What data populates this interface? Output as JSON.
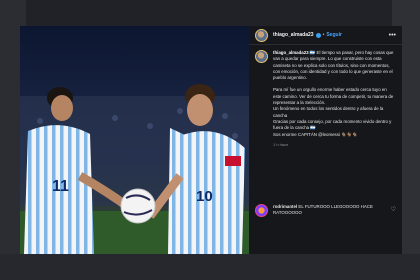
{
  "post": {
    "username": "thiago_almada23",
    "separator": "•",
    "follow_label": "Seguir",
    "more_label": "•••"
  },
  "caption": {
    "username": "thiago_almada23",
    "paragraph_1": "🇦🇷 El tiempo va pasar, pero hay cosas que van a quedar para siempre. Lo que construiste con esta camiseta no se explica solo con títulos, sino con momentos, con emoción, con identidad y con todo lo que generaste en el pueblo argentino.",
    "paragraph_2": "Para mí fue un orgullo enorme haber estado cerca tuyo en este camino. Ver de cerca tu forma de competir, tu manera de representar a la Selección.",
    "paragraph_3": "Un fenómeno en todos los sentidos dentro y afuera de la cancha",
    "paragraph_4": "Gracias por cada consejo, por cada momento vivido dentro y fuera de la cancha 🇦🇷",
    "paragraph_5": "Sos enorme CAPITÁN @leomessi 🐐🐐🐐",
    "time": "1 h hace"
  },
  "comment": {
    "username": "rodrimantel",
    "text": "EL FUTUROOO LLEGOOOOO HACE RATOOOOOO"
  },
  "colors": {
    "accent_link": "#4aa6ff",
    "verified": "#3aa3f2",
    "panel_bg": "#15171a"
  }
}
